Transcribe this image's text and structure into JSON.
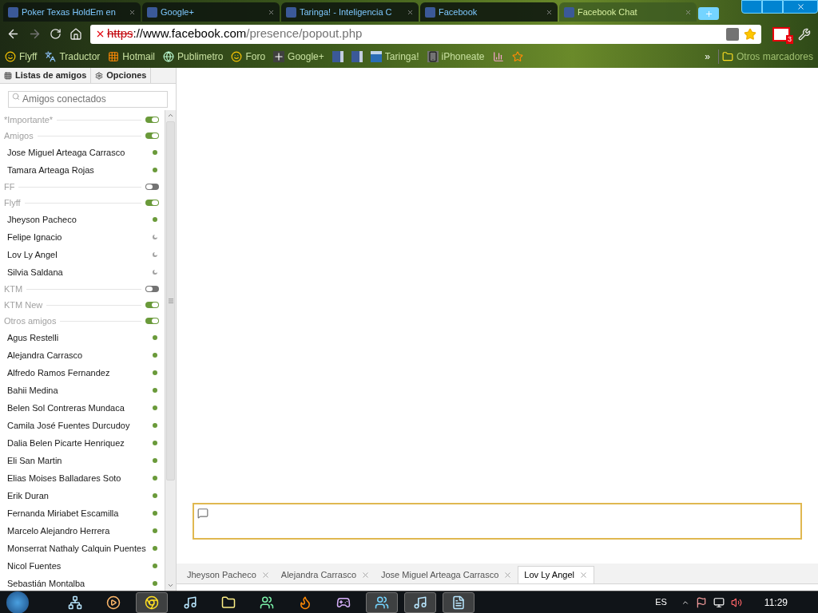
{
  "browser_tabs": [
    {
      "title": "Poker Texas HoldEm en",
      "selected": false
    },
    {
      "title": "Google+",
      "selected": false
    },
    {
      "title": "Taringa! - Inteligencia C",
      "selected": false
    },
    {
      "title": "Facebook",
      "selected": false
    },
    {
      "title": "Facebook Chat",
      "selected": true
    }
  ],
  "address": {
    "scheme": "https",
    "host": "://www.facebook.com",
    "path": "/presence/popout.php"
  },
  "mail_badge": "3",
  "bookmarks": [
    {
      "label": "Flyff",
      "kind": "smiley"
    },
    {
      "label": "Traductor",
      "kind": "translate"
    },
    {
      "label": "Hotmail",
      "kind": "windows"
    },
    {
      "label": "Publimetro",
      "kind": "globe"
    },
    {
      "label": "Foro",
      "kind": "smiley"
    },
    {
      "label": "Google+",
      "kind": "plus"
    },
    {
      "kind": "facebook"
    },
    {
      "kind": "facebook"
    },
    {
      "label": "Taringa!",
      "kind": "taringa"
    },
    {
      "label": "iPhoneate",
      "kind": "phone"
    },
    {
      "kind": "chart"
    },
    {
      "kind": "star"
    }
  ],
  "bookmarks_more": "»",
  "other_bookmarks": "Otros marcadores",
  "sidebar": {
    "tabs": [
      {
        "label": "Listas de amigos",
        "kind": "grid"
      },
      {
        "label": "Opciones",
        "kind": "gear"
      }
    ],
    "search": {
      "placeholder": "Amigos conectados"
    },
    "items": [
      {
        "kind": "group",
        "label": "*Importante*",
        "on": true
      },
      {
        "kind": "group",
        "label": "Amigos",
        "on": true
      },
      {
        "kind": "friend",
        "label": "Jose Miguel Arteaga Carrasco",
        "idle": false
      },
      {
        "kind": "friend",
        "label": "Tamara Arteaga Rojas",
        "idle": false
      },
      {
        "kind": "group",
        "label": "FF",
        "on": false
      },
      {
        "kind": "group",
        "label": "Flyff",
        "on": true
      },
      {
        "kind": "friend",
        "label": "Jheyson Pacheco",
        "idle": false
      },
      {
        "kind": "friend",
        "label": "Felipe Ignacio",
        "idle": true
      },
      {
        "kind": "friend",
        "label": "Lov Ly Angel",
        "idle": true
      },
      {
        "kind": "friend",
        "label": "Silvia Saldana",
        "idle": true
      },
      {
        "kind": "group",
        "label": "KTM",
        "on": false
      },
      {
        "kind": "group",
        "label": "KTM New",
        "on": true
      },
      {
        "kind": "group",
        "label": "Otros amigos",
        "on": true
      },
      {
        "kind": "friend",
        "label": "Agus Restelli",
        "idle": false
      },
      {
        "kind": "friend",
        "label": "Alejandra Carrasco",
        "idle": false
      },
      {
        "kind": "friend",
        "label": "Alfredo Ramos Fernandez",
        "idle": false
      },
      {
        "kind": "friend",
        "label": "Bahii Medina",
        "idle": false
      },
      {
        "kind": "friend",
        "label": "Belen Sol Contreras Mundaca",
        "idle": false
      },
      {
        "kind": "friend",
        "label": "Camila José Fuentes Durcudoy",
        "idle": false
      },
      {
        "kind": "friend",
        "label": "Dalia Belen Picarte Henriquez",
        "idle": false
      },
      {
        "kind": "friend",
        "label": "Eli San Martin",
        "idle": false
      },
      {
        "kind": "friend",
        "label": "Elias Moises Balladares Soto",
        "idle": false
      },
      {
        "kind": "friend",
        "label": "Erik Duran",
        "idle": false
      },
      {
        "kind": "friend",
        "label": "Fernanda Miriabet Escamilla",
        "idle": false
      },
      {
        "kind": "friend",
        "label": "Marcelo Alejandro Herrera",
        "idle": false
      },
      {
        "kind": "friend",
        "label": "Monserrat Nathaly Calquin Puentes",
        "idle": false
      },
      {
        "kind": "friend",
        "label": "Nicol Fuentes",
        "idle": false
      },
      {
        "kind": "friend",
        "label": "Sebastián Montalba",
        "idle": false
      }
    ]
  },
  "chat_tabs": [
    {
      "name": "Jheyson Pacheco",
      "selected": false
    },
    {
      "name": "Alejandra Carrasco",
      "selected": false
    },
    {
      "name": "Jose Miguel Arteaga Carrasco",
      "selected": false
    },
    {
      "name": "Lov Ly Angel",
      "selected": true
    }
  ],
  "taskbar": {
    "apps": [
      {
        "kind": "network",
        "active": false
      },
      {
        "kind": "media",
        "active": false
      },
      {
        "kind": "chrome",
        "active": true
      },
      {
        "kind": "itunes",
        "active": false
      },
      {
        "kind": "folder",
        "active": false
      },
      {
        "kind": "people",
        "active": false
      },
      {
        "kind": "firefox",
        "active": false
      },
      {
        "kind": "game",
        "active": false
      },
      {
        "kind": "messenger",
        "active": true
      },
      {
        "kind": "itunes",
        "active": true
      },
      {
        "kind": "notepad",
        "active": true
      }
    ],
    "language": "ES",
    "clock": "11:29"
  }
}
